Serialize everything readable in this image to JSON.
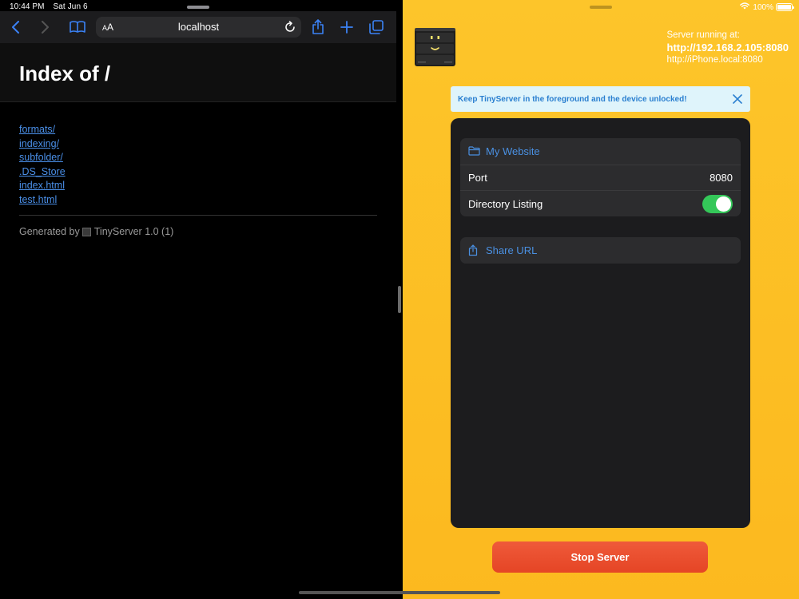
{
  "status_bar": {
    "time": "10:44 PM",
    "date": "Sat Jun 6",
    "battery": "100%"
  },
  "safari": {
    "url_aa_small": "A",
    "url_aa_large": "A",
    "url": "localhost",
    "page_title": "Index of /",
    "files": [
      "formats/",
      "indexing/",
      "subfolder/",
      ".DS_Store",
      "index.html",
      "test.html"
    ],
    "footer_prefix": "Generated by",
    "footer_suffix": "TinyServer 1.0 (1)"
  },
  "tinyserver": {
    "server_label": "Server running at:",
    "primary_url": "http://192.168.2.105:8080",
    "secondary_url": "http://iPhone.local:8080",
    "banner_text": "Keep TinyServer in the foreground and the device unlocked!",
    "website_label": "My Website",
    "port_label": "Port",
    "port_value": "8080",
    "directory_listing_label": "Directory Listing",
    "directory_listing_enabled": true,
    "share_label": "Share URL",
    "stop_label": "Stop Server"
  },
  "colors": {
    "link": "#4a8fe8",
    "accent_blue": "#4a90e2",
    "toggle_on": "#34c759",
    "stop_button": "#e54525",
    "background_yellow": "#fdc52a"
  }
}
